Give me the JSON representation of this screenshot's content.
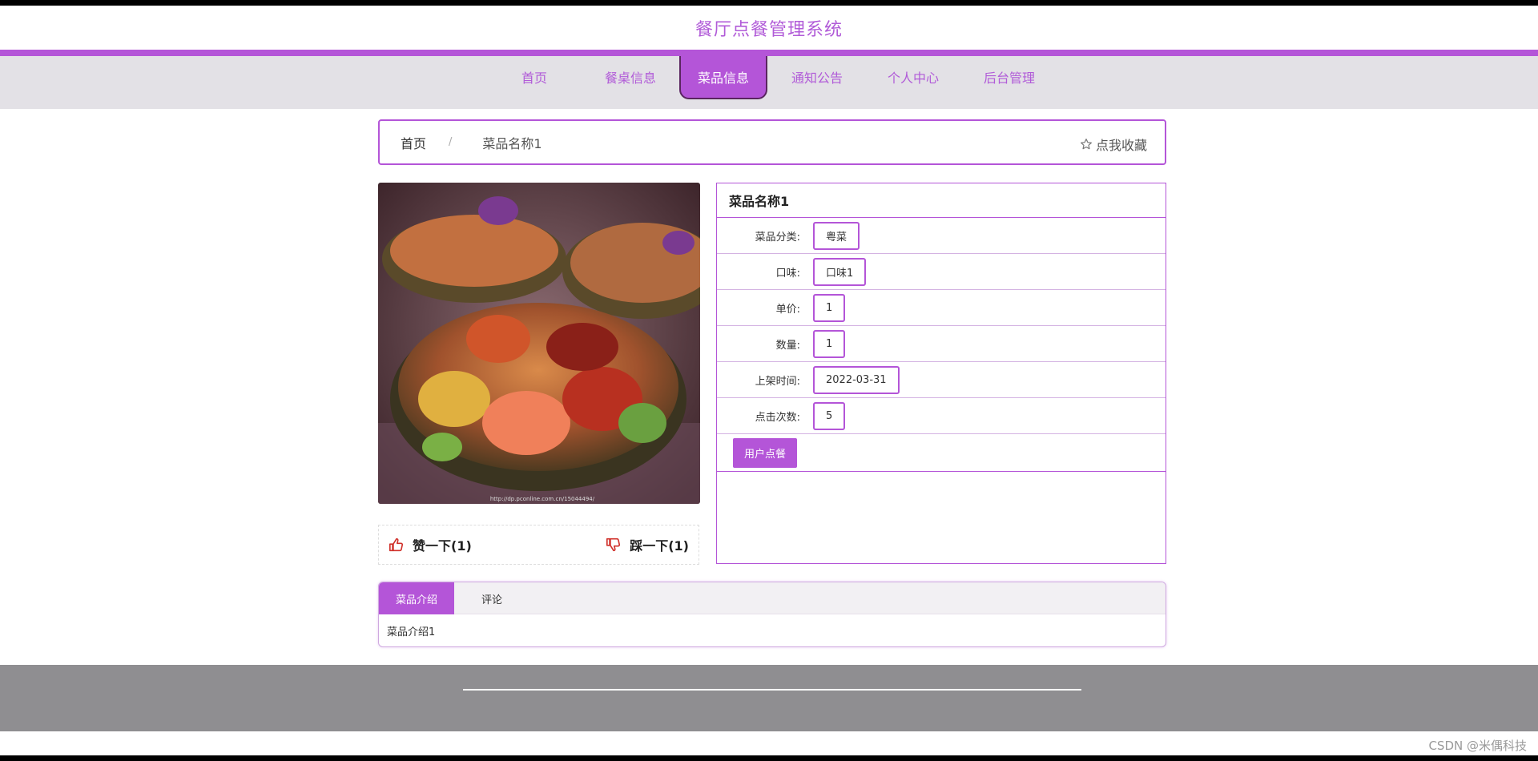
{
  "header": {
    "title": "餐厅点餐管理系统"
  },
  "colors": {
    "accent": "#b455d8",
    "nav_bg": "#e3e1e6",
    "footer_bg": "#8f8e91"
  },
  "nav": {
    "items": [
      {
        "label": "首页"
      },
      {
        "label": "餐桌信息"
      },
      {
        "label": "菜品信息",
        "active": true
      },
      {
        "label": "通知公告"
      },
      {
        "label": "个人中心"
      },
      {
        "label": "后台管理"
      }
    ]
  },
  "breadcrumb": {
    "home": "首页",
    "separator": "/",
    "current": "菜品名称1"
  },
  "favorite": {
    "icon": "star-outline-icon",
    "label": "点我收藏"
  },
  "image": {
    "caption": "http://dp.pconline.com.cn/15044494/"
  },
  "votes": {
    "like": {
      "icon": "thumbs-up-icon",
      "label": "赞一下(1)"
    },
    "dislike": {
      "icon": "thumbs-down-icon",
      "label": "踩一下(1)"
    }
  },
  "detail": {
    "title": "菜品名称1",
    "rows": [
      {
        "label": "菜品分类:",
        "value": "粤菜"
      },
      {
        "label": "口味:",
        "value": "口味1"
      },
      {
        "label": "单价:",
        "value": "1"
      },
      {
        "label": "数量:",
        "value": "1"
      },
      {
        "label": "上架时间:",
        "value": "2022-03-31"
      },
      {
        "label": "点击次数:",
        "value": "5"
      }
    ],
    "order_button": "用户点餐"
  },
  "tabs": {
    "items": [
      {
        "label": "菜品介绍",
        "active": true
      },
      {
        "label": "评论"
      }
    ],
    "content": "菜品介绍1"
  },
  "watermark": "CSDN @米偶科技"
}
